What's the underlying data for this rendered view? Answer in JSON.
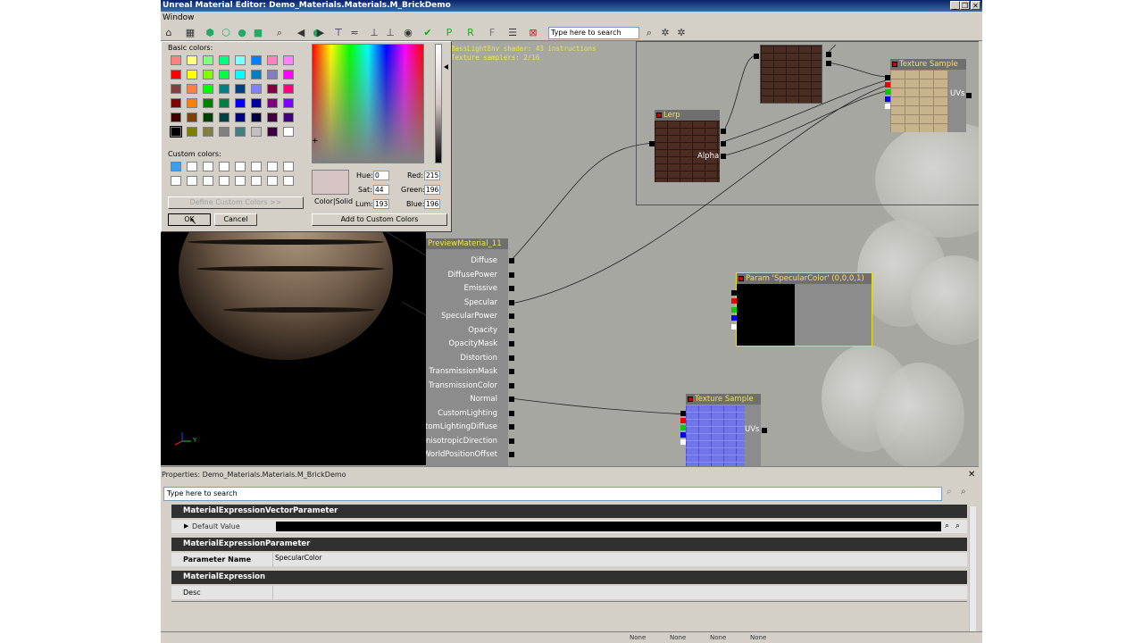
{
  "window": {
    "title": "Unreal Material Editor: Demo_Materials.Materials.M_BrickDemo",
    "menu": [
      "Window"
    ],
    "controls": [
      "_",
      "❐",
      "✕"
    ]
  },
  "toolbar": {
    "search_placeholder": "Type here to search",
    "icons": [
      "home-icon",
      "grid-icon",
      "sphere-icon",
      "cylinder-icon",
      "sphere-preview-icon",
      "cube-icon",
      "magnify-icon",
      "teapot-icon",
      "back-icon",
      "forward-icon",
      "connectors-icon",
      "hide-icon",
      "unhook-icon",
      "unhook2-icon",
      "toggle-icon",
      "apply-icon",
      "p-icon",
      "r-icon",
      "f-icon",
      "stats-icon",
      "delete-icon",
      "clear-search-icon",
      "filter-icon",
      "filter2-icon"
    ]
  },
  "canvas": {
    "stats_line1": "BassLightEnv shader: 43 instructions",
    "stats_line2": "Texture samplers: 2/16",
    "nodes": {
      "lerp_title": "Lerp",
      "lerp_pin_alpha": "Alpha",
      "texsample_top_title": "Texture Sample",
      "texsample_top_uvs": "UVs",
      "param_title": "Param 'SpecularColor' (0,0,0,1)",
      "texsample_bottom_title": "Texture Sample",
      "texsample_bottom_uvs": "UVs",
      "material_title": "PreviewMaterial_11",
      "material_inputs": [
        "Diffuse",
        "DiffusePower",
        "Emissive",
        "Specular",
        "SpecularPower",
        "Opacity",
        "OpacityMask",
        "Distortion",
        "TransmissionMask",
        "TransmissionColor",
        "Normal",
        "CustomLighting",
        "CustomLightingDiffuse",
        "AnisotropicDirection",
        "WorldPositionOffset"
      ]
    }
  },
  "preview": {
    "axis_label": "Y"
  },
  "color_dialog": {
    "basic_colors_label": "Basic colors:",
    "custom_colors_label": "Custom colors:",
    "basic_colors": [
      "#ff8080",
      "#ffff80",
      "#80ff80",
      "#00ff80",
      "#80ffff",
      "#0080ff",
      "#ff80c0",
      "#ff80ff",
      "#ff0000",
      "#ffff00",
      "#80ff00",
      "#00ff40",
      "#00ffff",
      "#0080c0",
      "#8080c0",
      "#ff00ff",
      "#804040",
      "#ff8040",
      "#00ff00",
      "#008080",
      "#004080",
      "#8080ff",
      "#800040",
      "#ff0080",
      "#800000",
      "#ff8000",
      "#008000",
      "#008040",
      "#0000ff",
      "#0000a0",
      "#800080",
      "#8000ff",
      "#400000",
      "#804000",
      "#004000",
      "#004040",
      "#000080",
      "#000040",
      "#400040",
      "#400080",
      "#000000",
      "#808000",
      "#808040",
      "#808080",
      "#408080",
      "#c0c0c0",
      "#400040",
      "#ffffff"
    ],
    "custom_colors": [
      "#3a9ff0",
      "#ffffff",
      "#ffffff",
      "#ffffff",
      "#ffffff",
      "#ffffff",
      "#ffffff",
      "#ffffff",
      "#ffffff",
      "#ffffff",
      "#ffffff",
      "#ffffff",
      "#ffffff",
      "#ffffff",
      "#ffffff",
      "#ffffff"
    ],
    "define_custom_label": "Define Custom Colors >>",
    "ok_label": "OK",
    "cancel_label": "Cancel",
    "color_solid_label": "Color|Solid",
    "hue_label": "Hue:",
    "hue": "0",
    "sat_label": "Sat:",
    "sat": "44",
    "lum_label": "Lum:",
    "lum": "193",
    "red_label": "Red:",
    "red": "215",
    "green_label": "Green:",
    "green": "196",
    "blue_label": "Blue:",
    "blue": "196",
    "add_custom_label": "Add to Custom Colors",
    "current_color": "#d7c4c4"
  },
  "properties": {
    "title": "Properties: Demo_Materials.Materials.M_BrickDemo",
    "close": "✕",
    "search_placeholder": "Type here to search",
    "cat1": "MaterialExpressionVectorParameter",
    "default_value_label": "Default Value",
    "cat2": "MaterialExpressionParameter",
    "param_name_label": "Parameter Name",
    "param_name_value": "SpecularColor",
    "cat3": "MaterialExpression",
    "desc_label": "Desc",
    "desc_value": ""
  },
  "statusbar": {
    "items": [
      "None",
      "None",
      "None",
      "None"
    ]
  }
}
